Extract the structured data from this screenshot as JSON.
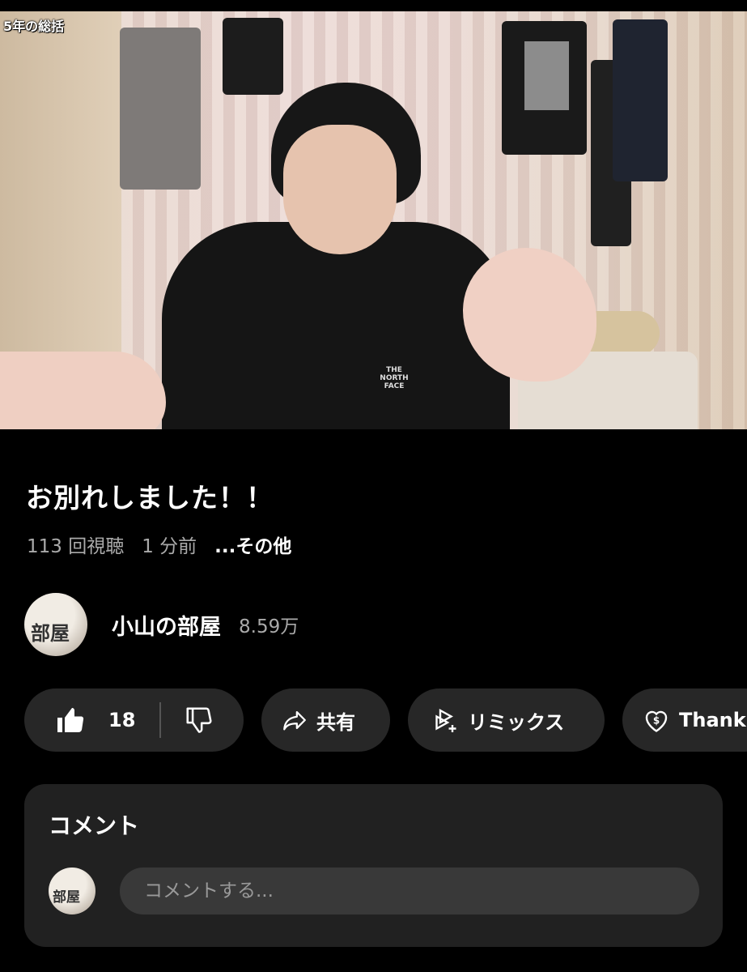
{
  "video": {
    "overlay_label": "5年の総括",
    "shirt_logo": "THE NORTH FACE",
    "progress_fraction": 0.0
  },
  "title": "お別れしました！！",
  "meta": {
    "views": "113 回視聴",
    "time": "1 分前",
    "more": "...その他"
  },
  "channel": {
    "name": "小山の部屋",
    "subscribers": "8.59万",
    "avatar_text": "部屋"
  },
  "actions": {
    "like_count": "18",
    "share_label": "共有",
    "remix_label": "リミックス",
    "thanks_label": "Thank"
  },
  "comments": {
    "header": "コメント",
    "placeholder": "コメントする..."
  },
  "colors": {
    "background": "#000000",
    "pill": "#272727",
    "panel": "#212121",
    "secondary_text": "#aaaaaa"
  }
}
